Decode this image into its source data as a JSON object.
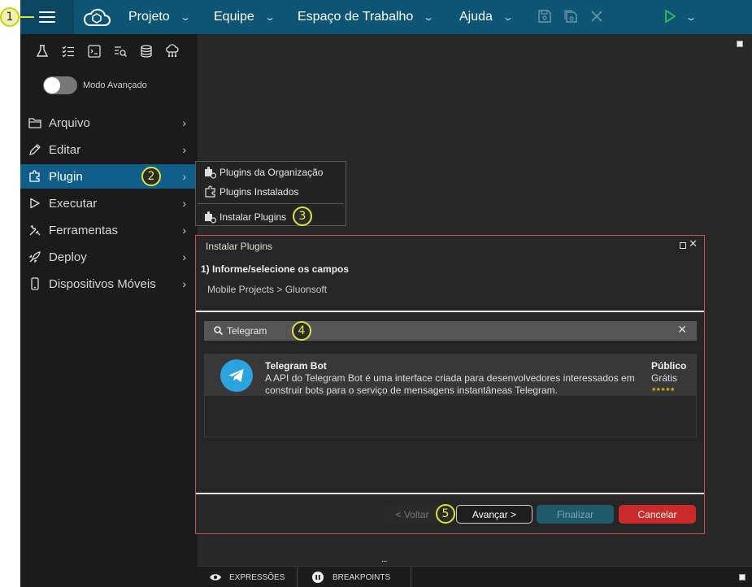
{
  "markers": [
    "1",
    "2",
    "3",
    "4",
    "5"
  ],
  "topbar": {
    "menus": [
      {
        "label": "Projeto"
      },
      {
        "label": "Equipe"
      },
      {
        "label": "Espaço de Trabalho"
      },
      {
        "label": "Ajuda"
      }
    ],
    "chevron": "⌄"
  },
  "sidebar": {
    "advanced_mode_label": "Modo Avançado",
    "advanced_mode_on": false,
    "items": [
      {
        "label": "Arquivo",
        "icon": "folder-icon"
      },
      {
        "label": "Editar",
        "icon": "pencil-icon"
      },
      {
        "label": "Plugin",
        "icon": "plugin-icon",
        "active": true
      },
      {
        "label": "Executar",
        "icon": "play-icon"
      },
      {
        "label": "Ferramentas",
        "icon": "tools-icon"
      },
      {
        "label": "Deploy",
        "icon": "rocket-icon"
      },
      {
        "label": "Dispositivos Móveis",
        "icon": "phone-icon"
      }
    ],
    "arrow": "›"
  },
  "submenu": {
    "items": [
      {
        "label": "Plugins da Organização"
      },
      {
        "label": "Plugins Instalados"
      },
      {
        "label": "Instalar Plugins"
      }
    ]
  },
  "dialog": {
    "title": "Instalar Plugins",
    "step_title": "1) Informe/selecione os campos",
    "breadcrumb": "Mobile Projects > Gluonsoft",
    "search_value": "Telegram",
    "result": {
      "title": "Telegram Bot",
      "description": "A API do Telegram Bot é uma interface criada para desenvolvedores interessados em construir bots para o serviço de mensagens instantâneas Telegram.",
      "visibility": "Público",
      "price": "Grátis",
      "rating": 5,
      "stars": "★★★★★"
    },
    "buttons": {
      "back": "< Voltar",
      "next": "Avançar >",
      "finish": "Finalizar",
      "cancel": "Cancelar"
    }
  },
  "bottombar": {
    "expressions": "EXPRESSÕES",
    "breakpoints": "BREAKPOINTS",
    "dots": "..."
  },
  "colors": {
    "topbar": "#0e5575",
    "active_item": "#0f5f8a",
    "cancel": "#cc2a2a",
    "finish": "#1f5a6b",
    "dialog_border": "#d24a4a",
    "telegram": "#2aa3de",
    "run": "#2fbf5a"
  }
}
